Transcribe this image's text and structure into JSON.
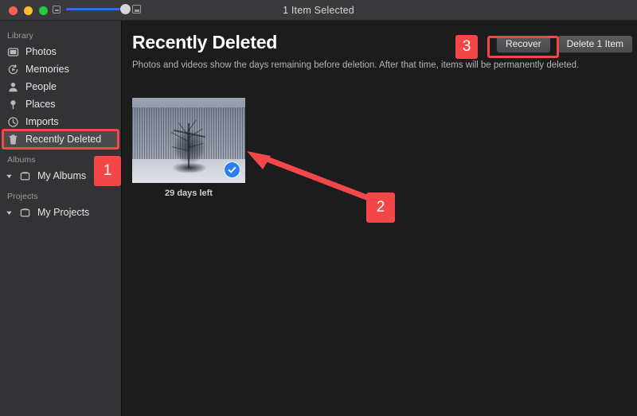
{
  "window": {
    "title": "1 Item Selected",
    "traffic_lights": [
      "close-red",
      "minimize-yellow",
      "maximize-green"
    ],
    "zoom_slider": {
      "small_icon": "small-thumbnail-icon",
      "large_icon": "large-thumbnail-icon",
      "value_percent": 88
    }
  },
  "sidebar": {
    "sections": [
      {
        "label": "Library",
        "items": [
          {
            "label": "Photos",
            "icon": "photos-icon",
            "selected": false
          },
          {
            "label": "Memories",
            "icon": "memories-icon",
            "selected": false
          },
          {
            "label": "People",
            "icon": "people-icon",
            "selected": false
          },
          {
            "label": "Places",
            "icon": "places-pin-icon",
            "selected": false
          },
          {
            "label": "Imports",
            "icon": "imports-clock-icon",
            "selected": false
          },
          {
            "label": "Recently Deleted",
            "icon": "trash-icon",
            "selected": true
          }
        ]
      },
      {
        "label": "Albums",
        "items": [
          {
            "label": "My Albums",
            "icon": "album-folder-icon",
            "selected": false,
            "disclosure": "expanded"
          }
        ]
      },
      {
        "label": "Projects",
        "items": [
          {
            "label": "My Projects",
            "icon": "album-folder-icon",
            "selected": false,
            "disclosure": "expanded"
          }
        ]
      }
    ]
  },
  "main": {
    "title": "Recently Deleted",
    "subtitle": "Photos and videos show the days remaining before deletion. After that time, items will be permanently deleted.",
    "buttons": {
      "recover": "Recover",
      "delete": "Delete 1 Item"
    },
    "photos": [
      {
        "caption": "29 days left",
        "selected": true,
        "check_icon": "check-circle-icon",
        "description": "snowy-field-with-bare-tree"
      }
    ]
  },
  "annotations": {
    "badges": [
      {
        "id": "1",
        "label": "1",
        "target": "sidebar-recently-deleted"
      },
      {
        "id": "2",
        "label": "2",
        "target": "photo-selection-checkmark"
      },
      {
        "id": "3",
        "label": "3",
        "target": "recover-button"
      }
    ],
    "highlight_color": "#f4474a",
    "arrow": {
      "from": "badge-2",
      "to": "photo-selection-checkmark"
    }
  },
  "colors": {
    "titlebar": "#3a3a3c",
    "sidebar": "#333335",
    "content": "#1c1c1c",
    "accent_blue": "#2b7ef0",
    "annotation_red": "#f4474a"
  }
}
